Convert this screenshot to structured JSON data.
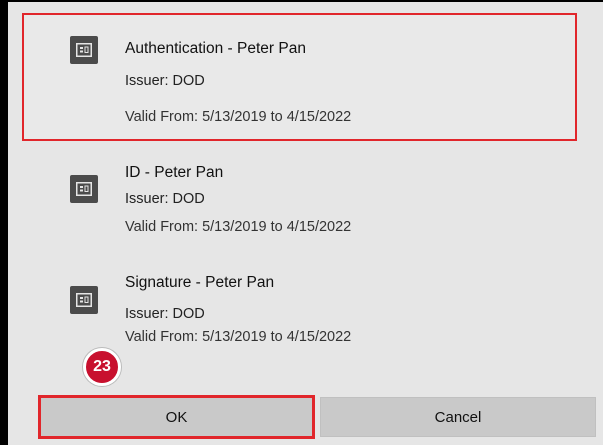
{
  "certificates": [
    {
      "title": "Authentication - Peter Pan",
      "issuer": "Issuer: DOD",
      "valid": "Valid From: 5/13/2019 to 4/15/2022",
      "selected": true,
      "icon": "certificate-icon"
    },
    {
      "title": "ID - Peter Pan",
      "issuer": "Issuer: DOD",
      "valid": "Valid From: 5/13/2019 to 4/15/2022",
      "selected": false,
      "icon": "certificate-icon"
    },
    {
      "title": "Signature - Peter Pan",
      "issuer": "Issuer: DOD",
      "valid": "Valid From: 5/13/2019 to 4/15/2022",
      "selected": false,
      "icon": "certificate-icon"
    }
  ],
  "buttons": {
    "ok_label": "OK",
    "cancel_label": "Cancel"
  },
  "step_badge": "23",
  "colors": {
    "highlight": "#e1262b",
    "badge": "#c8102e",
    "dialog_bg": "#e6e6e6",
    "button_bg": "#c9c9c9"
  }
}
